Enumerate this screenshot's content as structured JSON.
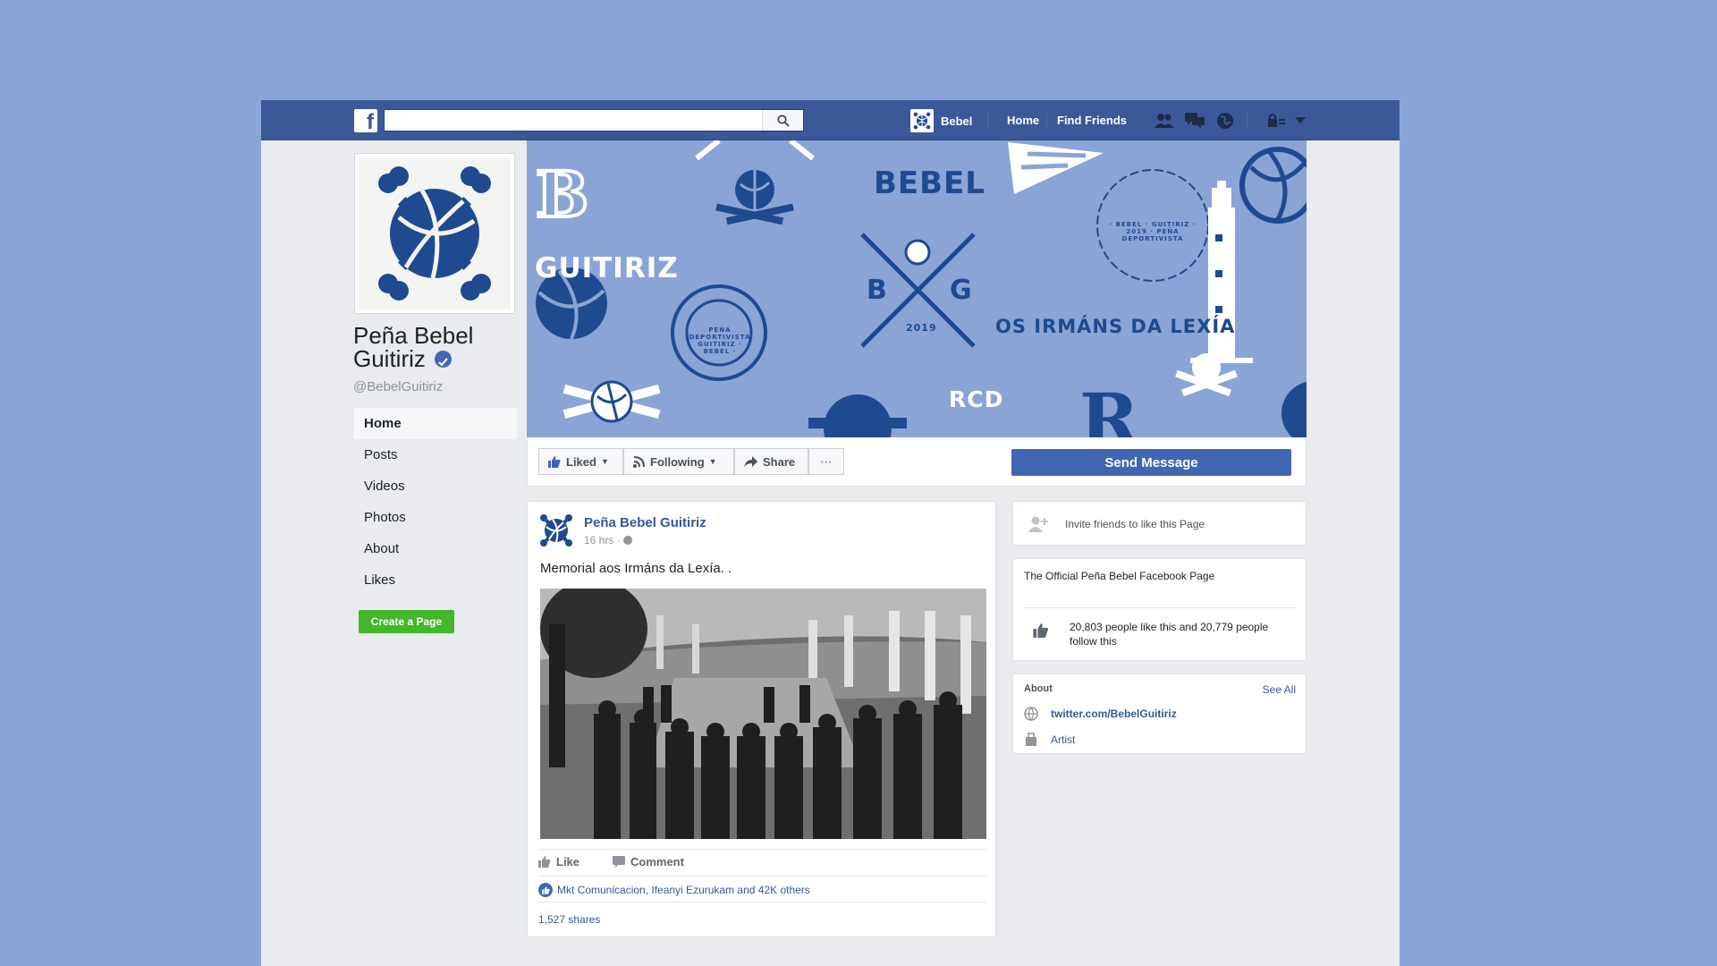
{
  "topbar": {
    "search_placeholder": "",
    "profile_name": "Bebel",
    "nav_home": "Home",
    "nav_find_friends": "Find Friends"
  },
  "page": {
    "name": "Peña Bebel Guitiriz",
    "handle": "@BebelGuitiriz"
  },
  "sidebar": {
    "items": [
      {
        "label": "Home",
        "active": true
      },
      {
        "label": "Posts"
      },
      {
        "label": "Videos"
      },
      {
        "label": "Photos"
      },
      {
        "label": "About"
      },
      {
        "label": "Likes"
      }
    ],
    "create_page": "Create a Page"
  },
  "cover": {
    "words": {
      "bebel": "BEBEL",
      "guitiriz": "GUITIRIZ",
      "irmans": "OS IRMÁNS DA LEXÍA",
      "rcd": "RCD",
      "b": "B",
      "g": "G",
      "year": "2019",
      "bg": "BG",
      "badge_text": "PEÑA DEPORTIVISTA GUITIRIZ · BEBEL ·",
      "ring_text": "· BEBEL · GUITIRIZ · 2019 · PEÑA DEPORTIVISTA"
    },
    "colors": {
      "bg": "#8aa4d6",
      "ink": "#1f4a8f"
    }
  },
  "actions": {
    "liked": "Liked",
    "following": "Following",
    "share": "Share",
    "more": "···",
    "send_message": "Send Message"
  },
  "post": {
    "author": "Peña Bebel Guitiriz",
    "time": "16 hrs · ",
    "text": "Memorial aos Irmáns da Lexía. .",
    "like": "Like",
    "comment": "Comment",
    "likes_summary": "Mkt Comunicacion, Ifeanyi Ezurukam and 42K others",
    "shares": "1,527 shares"
  },
  "right": {
    "invite": "Invite friends to like this Page",
    "official": "The Official Peña Bebel Facebook Page",
    "likes_line": "20,803 people like this and 20,779 people follow this",
    "about_title": "About",
    "see_all": "See All",
    "twitter": "twitter.com/BebelGuitiriz",
    "category": "Artist"
  },
  "colors": {
    "fb_blue": "#3b5998",
    "button_blue": "#4267b2",
    "green": "#42b72a",
    "page_bg": "#8aa6d8"
  }
}
